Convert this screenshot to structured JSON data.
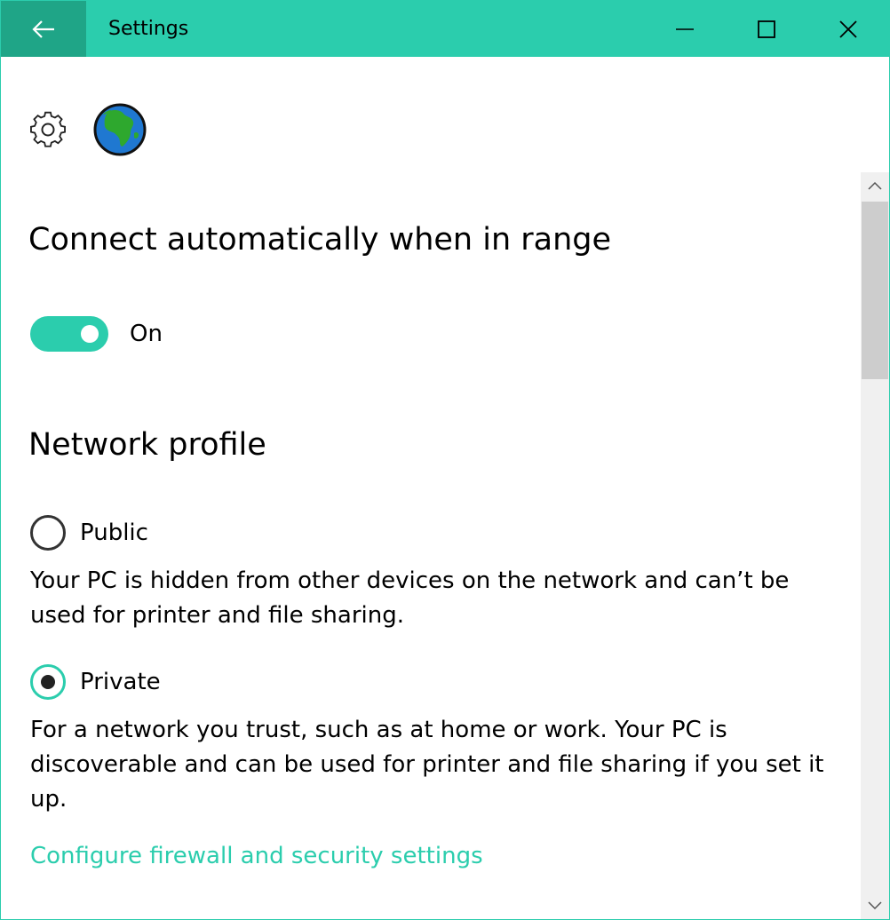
{
  "window": {
    "title": "Settings",
    "accent_color": "#2bcdad",
    "back_button_color": "#1fa587"
  },
  "header_icons": [
    "gear-icon",
    "globe-icon"
  ],
  "auto_connect": {
    "heading": "Connect automatically when in range",
    "toggle_state": "On"
  },
  "network_profile": {
    "heading": "Network profile",
    "options": [
      {
        "label": "Public",
        "selected": false,
        "description": "Your PC is hidden from other devices on the network and can’t be used for printer and file sharing."
      },
      {
        "label": "Private",
        "selected": true,
        "description": "For a network you trust, such as at home or work. Your PC is discoverable and can be used for printer and file sharing if you set it up."
      }
    ],
    "link": "Configure firewall and security settings"
  }
}
